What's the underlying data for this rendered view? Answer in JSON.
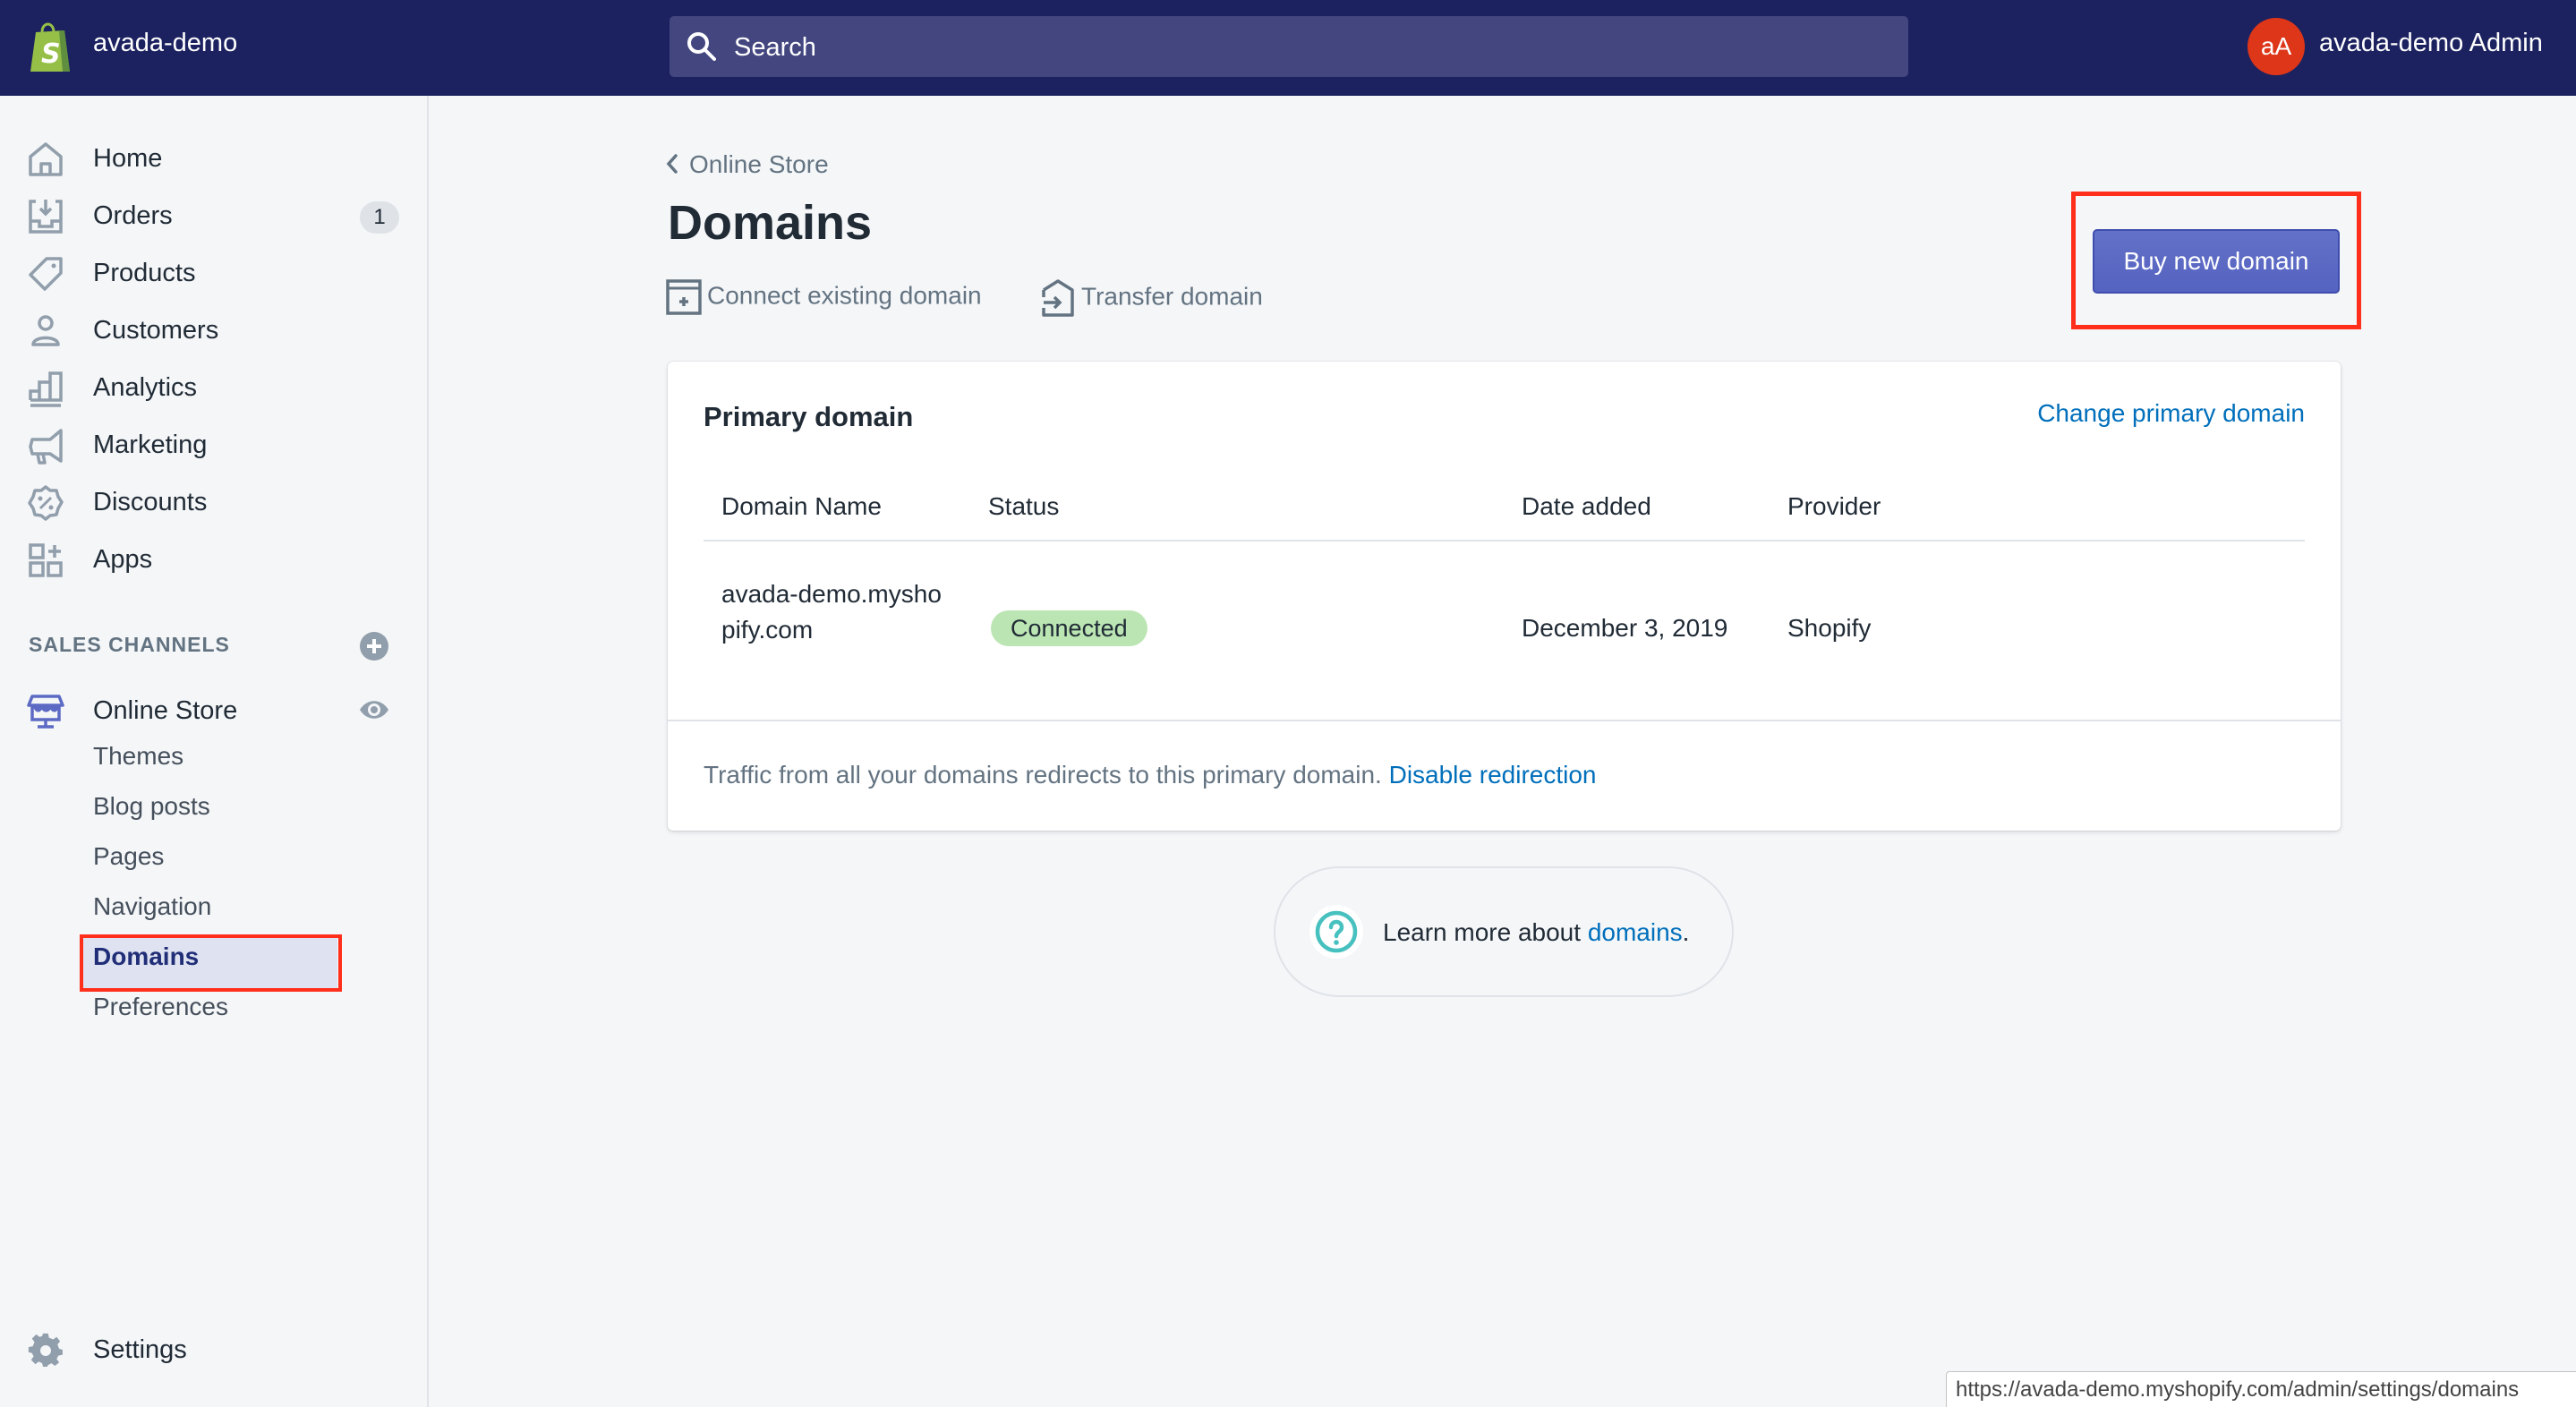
{
  "topbar": {
    "store_name": "avada-demo",
    "search_placeholder": "Search",
    "avatar_initials": "aA",
    "user_name": "avada-demo Admin"
  },
  "sidebar": {
    "items": [
      {
        "label": "Home",
        "icon": "home-icon"
      },
      {
        "label": "Orders",
        "icon": "orders-icon",
        "badge": "1"
      },
      {
        "label": "Products",
        "icon": "tag-icon"
      },
      {
        "label": "Customers",
        "icon": "person-icon"
      },
      {
        "label": "Analytics",
        "icon": "bar-chart-icon"
      },
      {
        "label": "Marketing",
        "icon": "megaphone-icon"
      },
      {
        "label": "Discounts",
        "icon": "discount-icon"
      },
      {
        "label": "Apps",
        "icon": "apps-icon"
      }
    ],
    "sales_channels_heading": "SALES CHANNELS",
    "online_store": {
      "label": "Online Store",
      "sub_items": [
        "Themes",
        "Blog posts",
        "Pages",
        "Navigation",
        "Domains",
        "Preferences"
      ],
      "active": "Domains"
    },
    "settings_label": "Settings"
  },
  "page": {
    "breadcrumb": "Online Store",
    "title": "Domains",
    "actions": {
      "connect": "Connect existing domain",
      "transfer": "Transfer domain"
    },
    "primary_button": "Buy new domain"
  },
  "card": {
    "title": "Primary domain",
    "header_link": "Change primary domain",
    "columns": [
      "Domain Name",
      "Status",
      "Date added",
      "Provider"
    ],
    "rows": [
      {
        "domain": "avada-demo.myshopify.com",
        "status": "Connected",
        "date_added": "December 3, 2019",
        "provider": "Shopify"
      }
    ],
    "footer_text": "Traffic from all your domains redirects to this primary domain.",
    "footer_link": "Disable redirection"
  },
  "help": {
    "prefix": "Learn more about ",
    "link": "domains",
    "suffix": "."
  },
  "status_bar_url": "https://avada-demo.myshopify.com/admin/settings/domains",
  "colors": {
    "topbar": "#1c2260",
    "primary_button": "#5c6ac4",
    "link": "#006fbb",
    "status_connected": "#bbe5b3",
    "avatar": "#de3618",
    "annotation": "#ff2f1b",
    "help_icon": "#47c1bf"
  }
}
